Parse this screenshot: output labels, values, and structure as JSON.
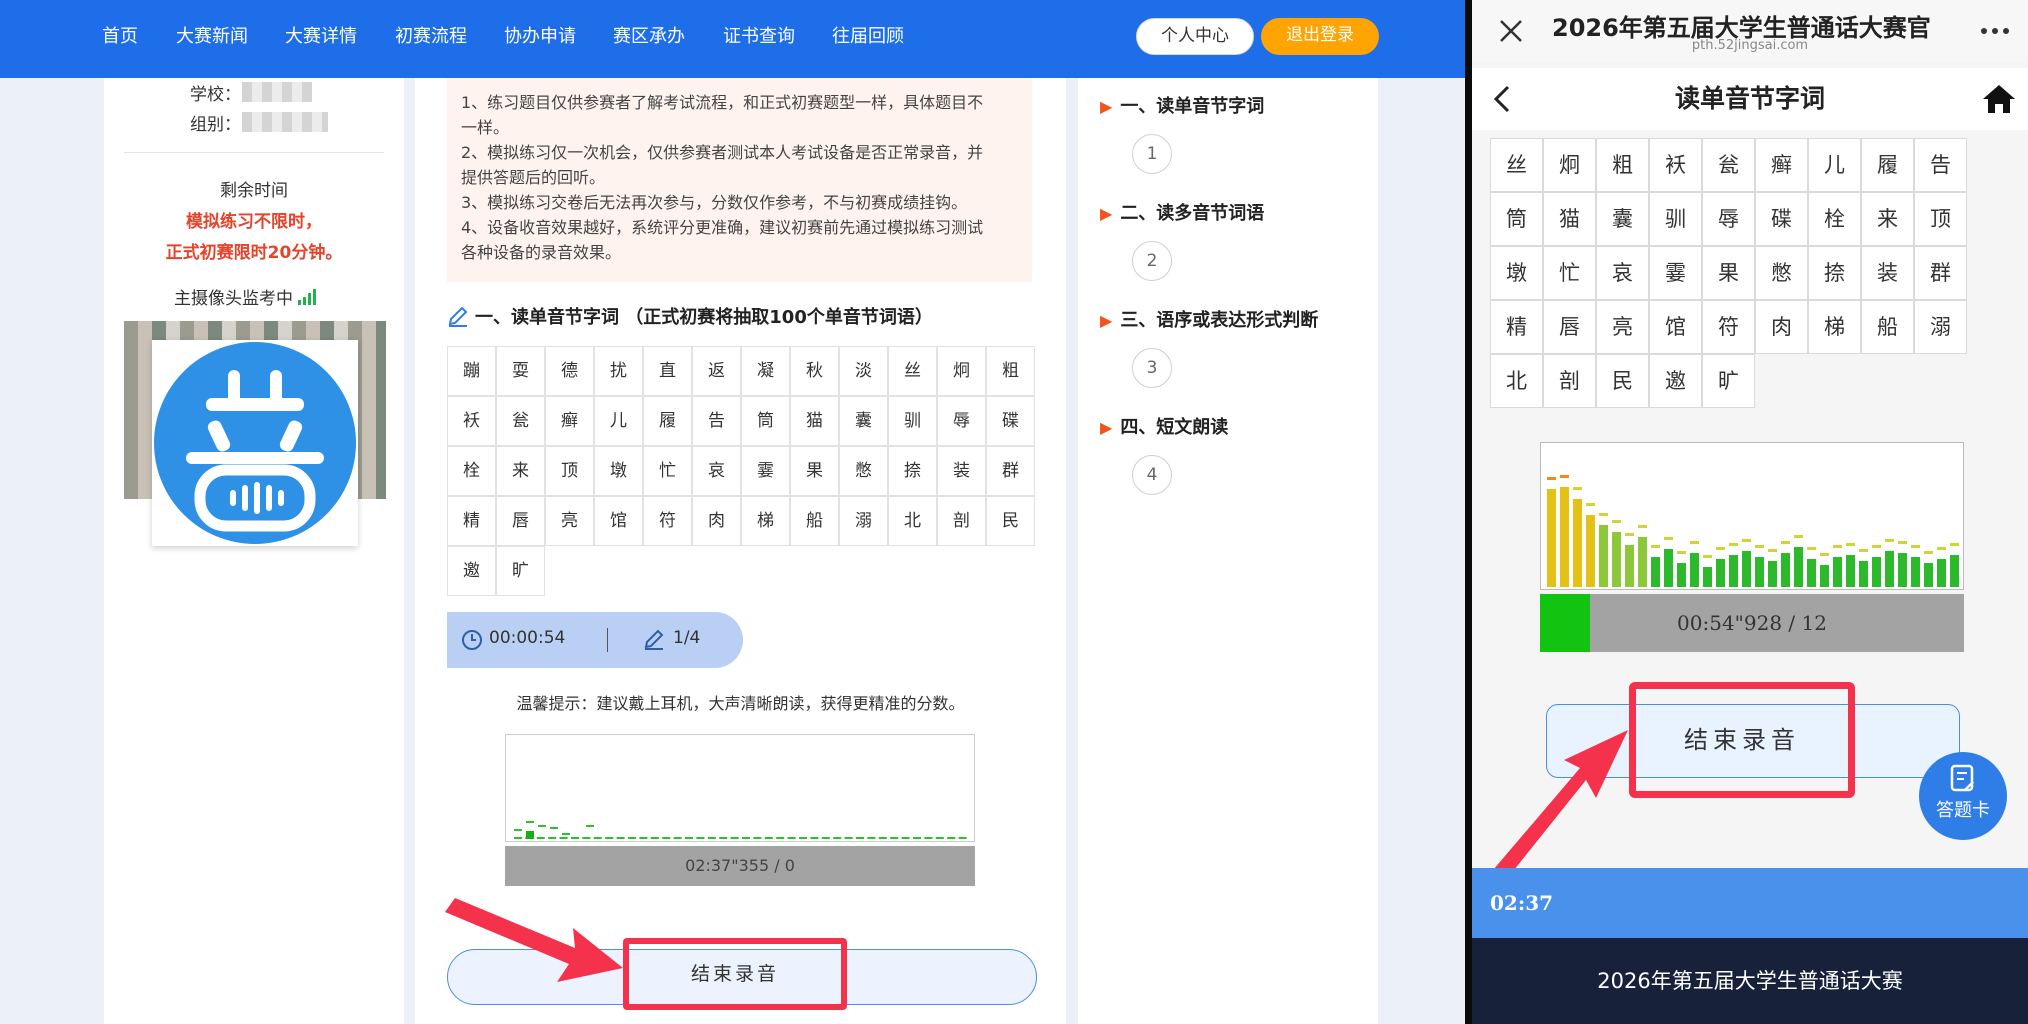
{
  "nav": {
    "items": [
      "首页",
      "大赛新闻",
      "大赛详情",
      "初赛流程",
      "协办申请",
      "赛区承办",
      "证书查询",
      "往届回顾"
    ],
    "personal_center": "个人中心",
    "logout": "退出登录"
  },
  "left_panel": {
    "school_label": "学校：",
    "group_label": "组别：",
    "remaining_time_label": "剩余时间",
    "practice_unlimited": "模拟练习不限时，",
    "formal_limit": "正式初赛限时20分钟。",
    "camera_label": "主摄像头监考中"
  },
  "notice": {
    "lines": [
      "1、练习题目仅供参赛者了解考试流程，和正式初赛题型一样，具体题目不",
      "一样。",
      "2、模拟练习仅一次机会，仅供参赛者测试本人考试设备是否正常录音，并",
      "提供答题后的回听。",
      "3、模拟练习交卷后无法再次参与，分数仅作参考，不与初赛成绩挂钩。",
      "4、设备收音效果越好，系统评分更准确，建议初赛前先通过模拟练习测试",
      "各种设备的录音效果。"
    ]
  },
  "section": {
    "heading": "一、读单音节字词 （正式初赛将抽取100个单音节词语）",
    "chars": [
      "蹦",
      "耍",
      "德",
      "扰",
      "直",
      "返",
      "凝",
      "秋",
      "淡",
      "丝",
      "炯",
      "粗",
      "袄",
      "瓮",
      "癣",
      "儿",
      "履",
      "告",
      "筒",
      "猫",
      "囊",
      "驯",
      "辱",
      "碟",
      "栓",
      "来",
      "顶",
      "墩",
      "忙",
      "哀",
      "霎",
      "果",
      "憋",
      "捺",
      "装",
      "群",
      "精",
      "唇",
      "亮",
      "馆",
      "符",
      "肉",
      "梯",
      "船",
      "溺",
      "北",
      "剖",
      "民",
      "邀",
      "旷"
    ]
  },
  "status": {
    "timer": "00:00:54",
    "progress": "1/4"
  },
  "tip": "温馨提示：建议戴上耳机，大声清晰朗读，获得更精准的分数。",
  "recorder": {
    "time_display": "02:37\"355 / 0",
    "end_button": "结束录音"
  },
  "sections_nav": [
    {
      "title": "一、读单音节字词",
      "number": "1"
    },
    {
      "title": "二、读多音节词语",
      "number": "2"
    },
    {
      "title": "三、语序或表达形式判断",
      "number": "3"
    },
    {
      "title": "四、短文朗读",
      "number": "4"
    }
  ],
  "mobile": {
    "title": "2026年第五届大学生普通话大赛官",
    "url": "pth.52jingsai.com",
    "page_title": "读单音节字词",
    "chars": [
      "丝",
      "炯",
      "粗",
      "袄",
      "瓮",
      "癣",
      "儿",
      "履",
      "告",
      "筒",
      "猫",
      "囊",
      "驯",
      "辱",
      "碟",
      "栓",
      "来",
      "顶",
      "墩",
      "忙",
      "哀",
      "霎",
      "果",
      "憋",
      "捺",
      "装",
      "群",
      "精",
      "唇",
      "亮",
      "馆",
      "符",
      "肉",
      "梯",
      "船",
      "溺",
      "北",
      "剖",
      "民",
      "邀",
      "旷"
    ],
    "time_display": "00:54\"928 / 12",
    "end_button": "结束录音",
    "answer_card": "答题卡",
    "bottom_time": "02:37",
    "footer": "2026年第五届大学生普通话大赛",
    "recording_progress": 0.12
  },
  "colors": {
    "nav_blue": "#1d6ee8",
    "logout_orange": "#ffa400",
    "highlight_red": "#f5324c",
    "accent_red": "#e5432b"
  },
  "icons": [
    "close-icon",
    "more-icon",
    "back-icon",
    "home-icon",
    "clock-icon",
    "pencil-icon",
    "signal-icon",
    "answer-card-icon",
    "microphone-logo-icon"
  ]
}
